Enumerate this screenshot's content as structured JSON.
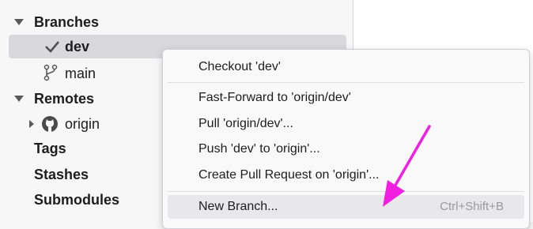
{
  "sidebar": {
    "branches_label": "Branches",
    "current_branch": "dev",
    "other_branch": "main",
    "remotes_label": "Remotes",
    "remote_origin": "origin",
    "tags_label": "Tags",
    "stashes_label": "Stashes",
    "submodules_label": "Submodules"
  },
  "context_menu": {
    "items": [
      {
        "label": "Checkout 'dev'"
      },
      {
        "label": "Fast-Forward to 'origin/dev'"
      },
      {
        "label": "Pull 'origin/dev'..."
      },
      {
        "label": "Push 'dev' to 'origin'..."
      },
      {
        "label": "Create Pull Request on 'origin'..."
      },
      {
        "label": "New Branch...",
        "shortcut": "Ctrl+Shift+B"
      }
    ]
  },
  "annotation": {
    "arrow_color": "#f21ee0"
  }
}
